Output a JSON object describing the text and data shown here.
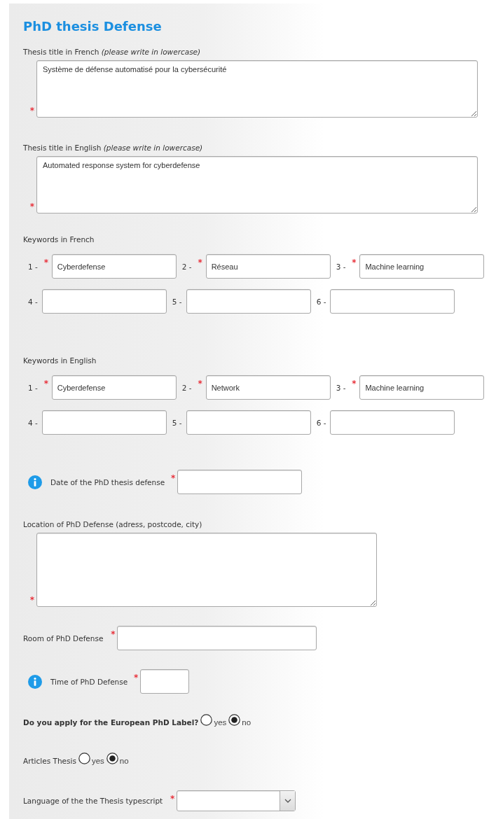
{
  "heading": "PhD thesis Defense",
  "fields": [
    {
      "kind": "textarea",
      "label": "Thesis title in French",
      "hint": "(please write in lowercase)",
      "value": "Système de défense automatisé pour la cybersécurité",
      "required_mark": "*"
    },
    {
      "kind": "textarea",
      "label": "Thesis title in English",
      "hint": "(please write in lowercase)",
      "value": "Automated response system for cyberdefense",
      "required_mark": "*"
    },
    {
      "kind": "keywords",
      "label": "Keywords in French",
      "items": [
        {
          "number": "1 -",
          "value": "Cyberdefense",
          "required_mark": "*"
        },
        {
          "number": "2 -",
          "value": "Réseau",
          "required_mark": "*"
        },
        {
          "number": "3 -",
          "value": "Machine learning",
          "required_mark": "*"
        },
        {
          "number": "4 -"
        },
        {
          "number": "5 -"
        },
        {
          "number": "6 -"
        }
      ]
    },
    {
      "kind": "keywords",
      "label": "Keywords in English",
      "items": [
        {
          "number": "1 -",
          "value": "Cyberdefense",
          "required_mark": "*"
        },
        {
          "number": "2 -",
          "value": "Network",
          "required_mark": "*"
        },
        {
          "number": "3 -",
          "value": "Machine learning",
          "required_mark": "*"
        },
        {
          "number": "4 -"
        },
        {
          "number": "5 -"
        },
        {
          "number": "6 -"
        }
      ]
    },
    {
      "kind": "date",
      "label": "Date of the PhD thesis defense",
      "info": true,
      "required_mark": "*"
    },
    {
      "kind": "location",
      "label": "Location of PhD Defense (adress, postcode, city)",
      "required_mark": "*"
    },
    {
      "kind": "text",
      "label": "Room of PhD Defense",
      "info": false,
      "required_mark": "*"
    },
    {
      "kind": "time",
      "label": "Time of PhD Defense",
      "info": true,
      "required_mark": "*"
    },
    {
      "kind": "radio",
      "label": "Do you apply for the European PhD Label?",
      "strong": true,
      "options": [
        {
          "label": "yes",
          "selected": false
        },
        {
          "label": "no",
          "selected": true
        }
      ]
    },
    {
      "kind": "radio",
      "label": "Articles Thesis",
      "strong": false,
      "options": [
        {
          "label": "yes",
          "selected": false
        },
        {
          "label": "no",
          "selected": true
        }
      ]
    },
    {
      "kind": "select",
      "label": "Language of the the Thesis typescript",
      "required_mark": "*"
    }
  ]
}
